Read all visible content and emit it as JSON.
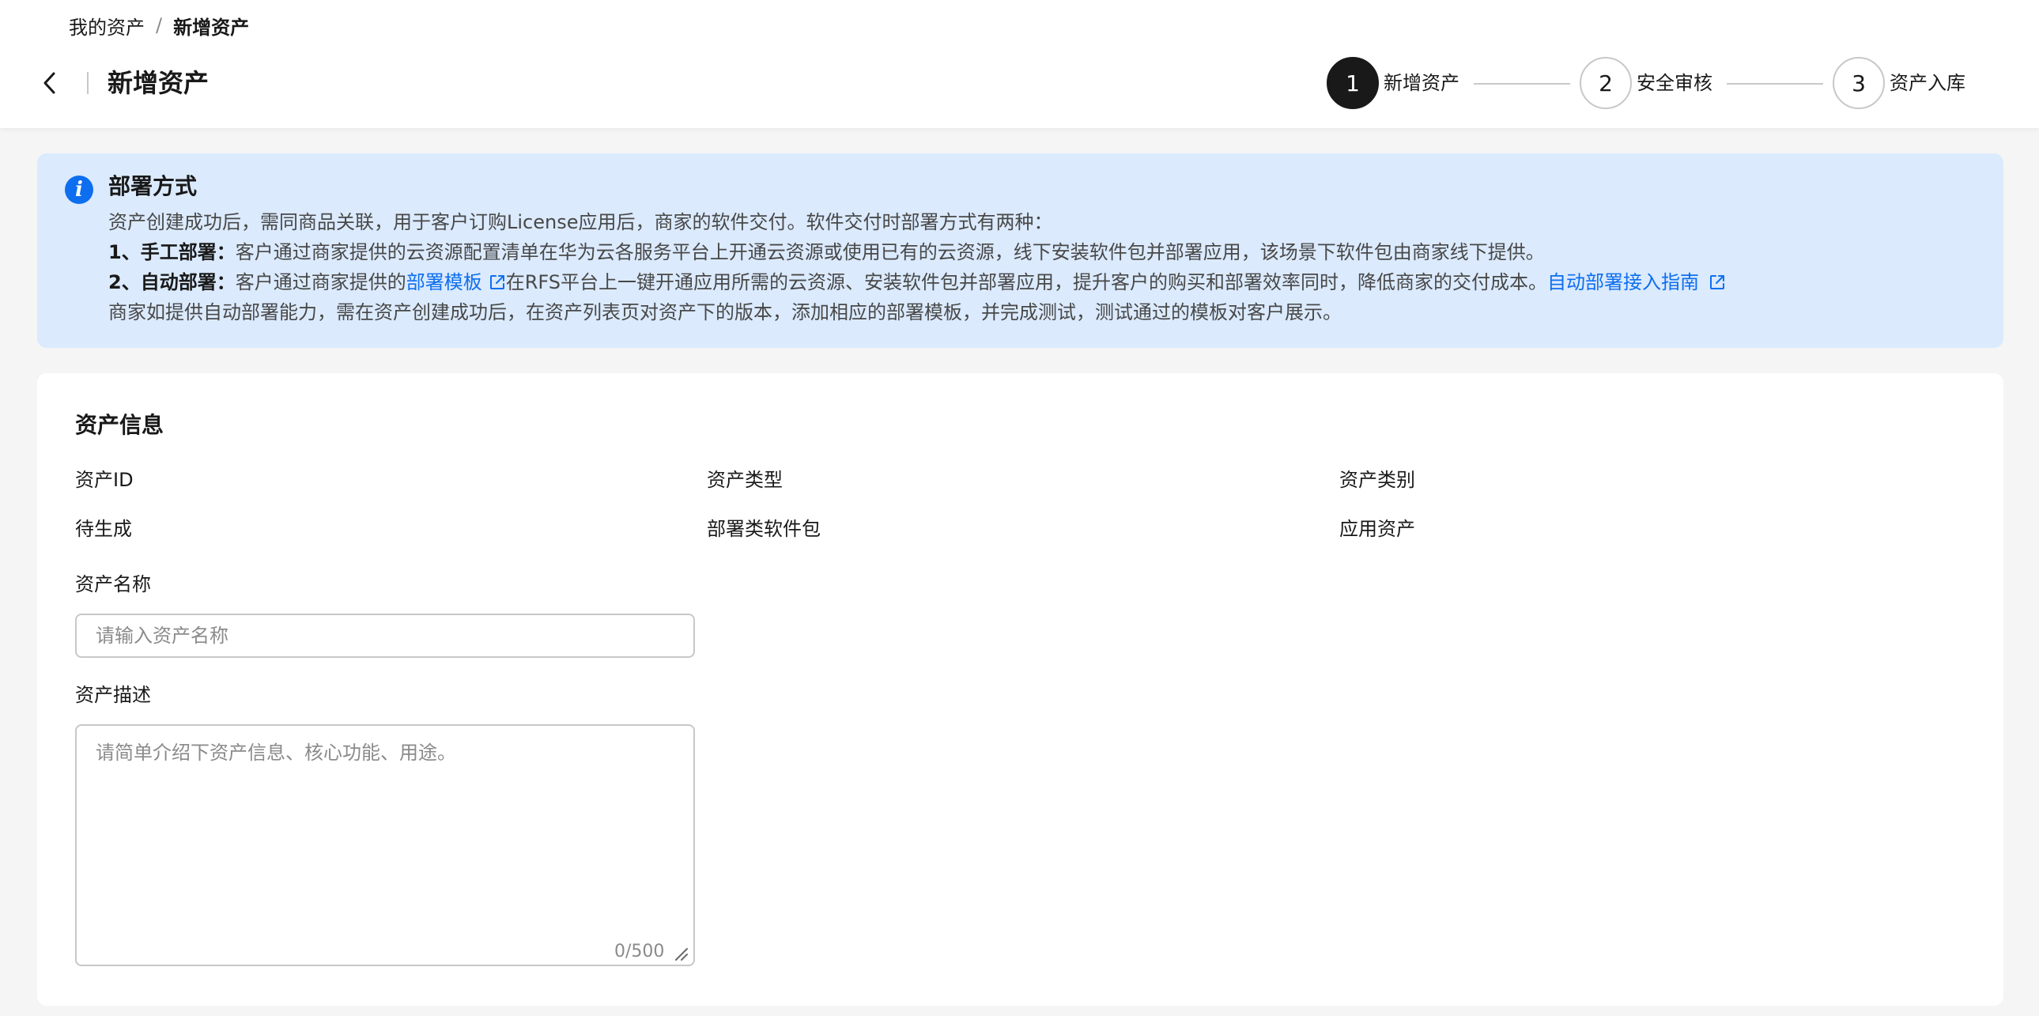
{
  "breadcrumb": {
    "root": "我的资产",
    "separator": "/",
    "current": "新增资产"
  },
  "header": {
    "title": "新增资产",
    "back_icon": "chevron-left-icon"
  },
  "steps": [
    {
      "number": "1",
      "label": "新增资产",
      "active": true
    },
    {
      "number": "2",
      "label": "安全审核",
      "active": false
    },
    {
      "number": "3",
      "label": "资产入库",
      "active": false
    }
  ],
  "notice": {
    "icon": "info-icon",
    "title": "部署方式",
    "intro": "资产创建成功后，需同商品关联，用于客户订购License应用后，商家的软件交付。软件交付时部署方式有两种：",
    "manual_label": "1、手工部署：",
    "manual_text": "客户通过商家提供的云资源配置清单在华为云各服务平台上开通云资源或使用已有的云资源，线下安装软件包并部署应用，该场景下软件包由商家线下提供。",
    "auto_label": "2、自动部署：",
    "auto_text_1": "客户通过商家提供的",
    "auto_link": "部署模板",
    "auto_text_2": "在RFS平台上一键开通应用所需的云资源、安装软件包并部署应用，提升客户的购买和部署效率同时，降低商家的交付成本。",
    "guide_link": "自动部署接入指南",
    "footer": "商家如提供自动部署能力，需在资产创建成功后，在资产列表页对资产下的版本，添加相应的部署模板，并完成测试，测试通过的模板对客户展示。",
    "link_color": "#0d6eef",
    "background_color": "#dbeafd"
  },
  "asset_info": {
    "section_title": "资产信息",
    "fields": [
      {
        "label": "资产ID",
        "value": "待生成"
      },
      {
        "label": "资产类型",
        "value": "部署类软件包"
      },
      {
        "label": "资产类别",
        "value": "应用资产"
      }
    ],
    "name_label": "资产名称",
    "name_placeholder": "请输入资产名称",
    "name_value": "",
    "desc_label": "资产描述",
    "desc_placeholder": "请简单介绍下资产信息、核心功能、用途。",
    "desc_value": "",
    "desc_counter": "0/500"
  }
}
